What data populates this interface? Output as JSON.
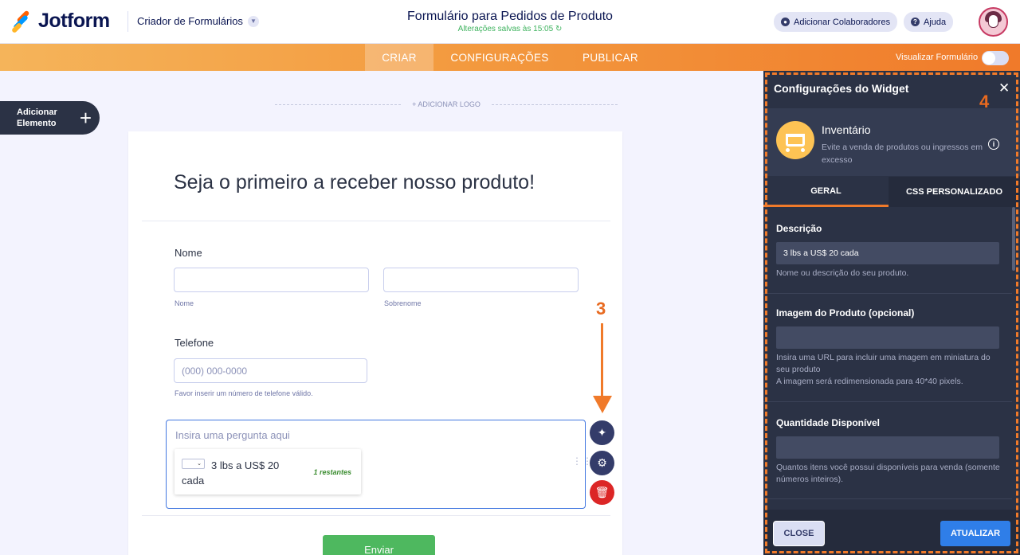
{
  "header": {
    "brand": "Jotform",
    "builder_menu": "Criador de Formulários",
    "form_title": "Formulário para Pedidos de Produto",
    "saved_status": "Alterações salvas às 15:05",
    "collaborators_label": "Adicionar Colaboradores",
    "help_label": "Ajuda"
  },
  "nav": {
    "tabs": [
      "CRIAR",
      "CONFIGURAÇÕES",
      "PUBLICAR"
    ],
    "active_tab": "CRIAR",
    "preview_label": "Visualizar Formulário"
  },
  "canvas": {
    "add_element": "Adicionar Elemento",
    "add_logo": "+ ADICIONAR LOGO"
  },
  "form": {
    "heading": "Seja o primeiro a receber nosso produto!",
    "name_label": "Nome",
    "first_name_sub": "Nome",
    "last_name_sub": "Sobrenome",
    "phone_label": "Telefone",
    "phone_placeholder": "(000) 000-0000",
    "phone_sub": "Favor inserir um número de telefone válido.",
    "widget_question": "Insira uma pergunta aqui",
    "inventory_item": "3 lbs a US$ 20 cada",
    "inventory_remaining": "1 restantes",
    "submit_label": "Enviar"
  },
  "annotations": {
    "step_3": "3",
    "step_4": "4"
  },
  "panel": {
    "title": "Configurações do Widget",
    "widget_name": "Inventário",
    "widget_desc": "Evite a venda de produtos ou ingressos em excesso",
    "tabs": [
      "GERAL",
      "CSS PERSONALIZADO"
    ],
    "description_label": "Descrição",
    "description_value": "3 lbs a US$ 20 cada",
    "description_help": "Nome ou descrição do seu produto.",
    "image_label": "Imagem do Produto (opcional)",
    "image_value": "",
    "image_help_1": "Insira uma URL para incluir uma imagem em miniatura do seu produto",
    "image_help_2": "A imagem será redimensionada para 40*40 pixels.",
    "quantity_label": "Quantidade Disponível",
    "quantity_value": "",
    "quantity_help": "Quantos itens você possui disponíveis para venda (somente números inteiros).",
    "close_label": "CLOSE",
    "update_label": "ATUALIZAR"
  },
  "colors": {
    "accent_orange": "#f07a2a",
    "panel_bg": "#2b3245",
    "submit_green": "#4eb85f",
    "update_blue": "#2f7ee8"
  }
}
